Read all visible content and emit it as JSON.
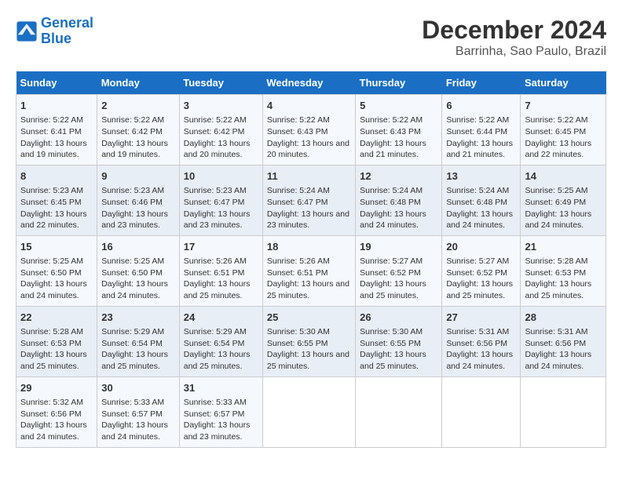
{
  "logo": {
    "line1": "General",
    "line2": "Blue"
  },
  "title": "December 2024",
  "subtitle": "Barrinha, Sao Paulo, Brazil",
  "weekdays": [
    "Sunday",
    "Monday",
    "Tuesday",
    "Wednesday",
    "Thursday",
    "Friday",
    "Saturday"
  ],
  "weeks": [
    [
      {
        "day": "1",
        "sunrise": "5:22 AM",
        "sunset": "6:41 PM",
        "daylight": "13 hours and 19 minutes."
      },
      {
        "day": "2",
        "sunrise": "5:22 AM",
        "sunset": "6:42 PM",
        "daylight": "13 hours and 19 minutes."
      },
      {
        "day": "3",
        "sunrise": "5:22 AM",
        "sunset": "6:42 PM",
        "daylight": "13 hours and 20 minutes."
      },
      {
        "day": "4",
        "sunrise": "5:22 AM",
        "sunset": "6:43 PM",
        "daylight": "13 hours and 20 minutes."
      },
      {
        "day": "5",
        "sunrise": "5:22 AM",
        "sunset": "6:43 PM",
        "daylight": "13 hours and 21 minutes."
      },
      {
        "day": "6",
        "sunrise": "5:22 AM",
        "sunset": "6:44 PM",
        "daylight": "13 hours and 21 minutes."
      },
      {
        "day": "7",
        "sunrise": "5:22 AM",
        "sunset": "6:45 PM",
        "daylight": "13 hours and 22 minutes."
      }
    ],
    [
      {
        "day": "8",
        "sunrise": "5:23 AM",
        "sunset": "6:45 PM",
        "daylight": "13 hours and 22 minutes."
      },
      {
        "day": "9",
        "sunrise": "5:23 AM",
        "sunset": "6:46 PM",
        "daylight": "13 hours and 23 minutes."
      },
      {
        "day": "10",
        "sunrise": "5:23 AM",
        "sunset": "6:47 PM",
        "daylight": "13 hours and 23 minutes."
      },
      {
        "day": "11",
        "sunrise": "5:24 AM",
        "sunset": "6:47 PM",
        "daylight": "13 hours and 23 minutes."
      },
      {
        "day": "12",
        "sunrise": "5:24 AM",
        "sunset": "6:48 PM",
        "daylight": "13 hours and 24 minutes."
      },
      {
        "day": "13",
        "sunrise": "5:24 AM",
        "sunset": "6:48 PM",
        "daylight": "13 hours and 24 minutes."
      },
      {
        "day": "14",
        "sunrise": "5:25 AM",
        "sunset": "6:49 PM",
        "daylight": "13 hours and 24 minutes."
      }
    ],
    [
      {
        "day": "15",
        "sunrise": "5:25 AM",
        "sunset": "6:50 PM",
        "daylight": "13 hours and 24 minutes."
      },
      {
        "day": "16",
        "sunrise": "5:25 AM",
        "sunset": "6:50 PM",
        "daylight": "13 hours and 24 minutes."
      },
      {
        "day": "17",
        "sunrise": "5:26 AM",
        "sunset": "6:51 PM",
        "daylight": "13 hours and 25 minutes."
      },
      {
        "day": "18",
        "sunrise": "5:26 AM",
        "sunset": "6:51 PM",
        "daylight": "13 hours and 25 minutes."
      },
      {
        "day": "19",
        "sunrise": "5:27 AM",
        "sunset": "6:52 PM",
        "daylight": "13 hours and 25 minutes."
      },
      {
        "day": "20",
        "sunrise": "5:27 AM",
        "sunset": "6:52 PM",
        "daylight": "13 hours and 25 minutes."
      },
      {
        "day": "21",
        "sunrise": "5:28 AM",
        "sunset": "6:53 PM",
        "daylight": "13 hours and 25 minutes."
      }
    ],
    [
      {
        "day": "22",
        "sunrise": "5:28 AM",
        "sunset": "6:53 PM",
        "daylight": "13 hours and 25 minutes."
      },
      {
        "day": "23",
        "sunrise": "5:29 AM",
        "sunset": "6:54 PM",
        "daylight": "13 hours and 25 minutes."
      },
      {
        "day": "24",
        "sunrise": "5:29 AM",
        "sunset": "6:54 PM",
        "daylight": "13 hours and 25 minutes."
      },
      {
        "day": "25",
        "sunrise": "5:30 AM",
        "sunset": "6:55 PM",
        "daylight": "13 hours and 25 minutes."
      },
      {
        "day": "26",
        "sunrise": "5:30 AM",
        "sunset": "6:55 PM",
        "daylight": "13 hours and 25 minutes."
      },
      {
        "day": "27",
        "sunrise": "5:31 AM",
        "sunset": "6:56 PM",
        "daylight": "13 hours and 24 minutes."
      },
      {
        "day": "28",
        "sunrise": "5:31 AM",
        "sunset": "6:56 PM",
        "daylight": "13 hours and 24 minutes."
      }
    ],
    [
      {
        "day": "29",
        "sunrise": "5:32 AM",
        "sunset": "6:56 PM",
        "daylight": "13 hours and 24 minutes."
      },
      {
        "day": "30",
        "sunrise": "5:33 AM",
        "sunset": "6:57 PM",
        "daylight": "13 hours and 24 minutes."
      },
      {
        "day": "31",
        "sunrise": "5:33 AM",
        "sunset": "6:57 PM",
        "daylight": "13 hours and 23 minutes."
      },
      null,
      null,
      null,
      null
    ]
  ]
}
